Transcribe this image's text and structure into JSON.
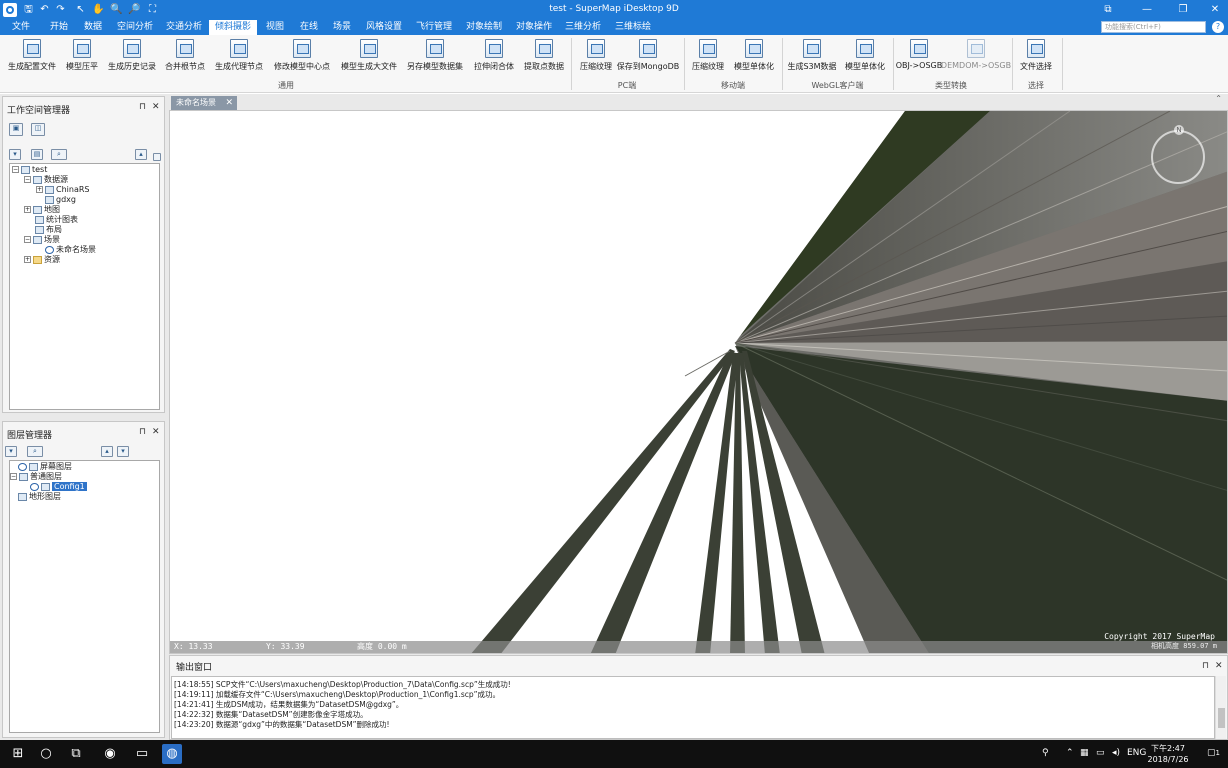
{
  "window": {
    "title": "test - SuperMap iDesktop 9D",
    "controls": [
      "⧉",
      "—",
      "❐",
      "✕"
    ]
  },
  "quick_access": [
    "🖫",
    "↶",
    "↷",
    "↖",
    "✋",
    "🔍",
    "🔎",
    "⛶"
  ],
  "menu": {
    "items": [
      "文件",
      "开始",
      "数据",
      "空间分析",
      "交通分析",
      "倾斜摄影",
      "视图",
      "在线",
      "场景",
      "风格设置",
      "飞行管理",
      "对象绘制",
      "对象操作",
      "三维分析",
      "三维标绘"
    ],
    "active": "倾斜摄影",
    "search_placeholder": "功能搜索(Ctrl+F)",
    "help": "?"
  },
  "ribbon": {
    "buttons": [
      {
        "label": "生成配置文件",
        "enabled": true
      },
      {
        "label": "模型压平",
        "enabled": true
      },
      {
        "label": "生成历史记录",
        "enabled": true
      },
      {
        "label": "合并根节点",
        "enabled": true
      },
      {
        "label": "生成代理节点",
        "enabled": true
      },
      {
        "label": "修改模型中心点",
        "enabled": true
      },
      {
        "label": "模型生成大文件",
        "enabled": true
      },
      {
        "label": "另存模型数据集",
        "enabled": true
      },
      {
        "label": "拉伸闭合体",
        "enabled": true
      },
      {
        "label": "提取点数据",
        "enabled": true
      },
      {
        "label": "压缩纹理",
        "enabled": true
      },
      {
        "label": "保存到MongoDB",
        "enabled": true
      },
      {
        "label": "压缩纹理",
        "enabled": true
      },
      {
        "label": "模型单体化",
        "enabled": true
      },
      {
        "label": "生成S3M数据",
        "enabled": true
      },
      {
        "label": "模型单体化",
        "enabled": true
      },
      {
        "label": "OBJ->OSGB",
        "enabled": true
      },
      {
        "label": "DEMDOM->OSGB",
        "enabled": false
      },
      {
        "label": "文件选择",
        "enabled": true
      }
    ],
    "groups": [
      "通用",
      "PC端",
      "移动端",
      "WebGL客户端",
      "类型转换",
      "选择"
    ]
  },
  "workspace_panel": {
    "title": "工作空间管理器",
    "tree": [
      {
        "label": "test",
        "expander": "⊟",
        "icon": "workspace-icon"
      },
      {
        "label": "数据源",
        "expander": "⊟",
        "icon": "datasource-icon"
      },
      {
        "label": "ChinaRS",
        "expander": "⊞",
        "icon": "database-icon"
      },
      {
        "label": "gdxg",
        "expander": "",
        "icon": "database-icon"
      },
      {
        "label": "地图",
        "expander": "⊞",
        "icon": "map-icon"
      },
      {
        "label": "统计图表",
        "expander": "",
        "icon": "chart-icon"
      },
      {
        "label": "布局",
        "expander": "",
        "icon": "layout-icon"
      },
      {
        "label": "场景",
        "expander": "⊟",
        "icon": "scene-icon"
      },
      {
        "label": "未命名场景",
        "expander": "",
        "icon": "globe-icon"
      },
      {
        "label": "资源",
        "expander": "⊞",
        "icon": "resource-icon"
      }
    ]
  },
  "layer_panel": {
    "title": "图层管理器",
    "tree": [
      {
        "label": "屏幕图层",
        "expander": "",
        "icon": "screen-layer-icon"
      },
      {
        "label": "普通图层",
        "expander": "⊟",
        "icon": "normal-layer-icon"
      },
      {
        "label": "Config1",
        "expander": "",
        "icon": "model-layer-icon"
      },
      {
        "label": "地形图层",
        "expander": "",
        "icon": "terrain-layer-icon"
      }
    ]
  },
  "scene": {
    "tab_label": "未命名场景",
    "compass_label": "N",
    "x_label": "X: 13.33",
    "y_label": "Y: 33.39",
    "h_label": "高度 0.00 m",
    "copyright": "Copyright 2017 SuperMap",
    "altitude": "相机高度 859.07 m"
  },
  "output": {
    "title": "输出窗口",
    "lines": [
      "[14:18:55] SCP文件“C:\\Users\\maxucheng\\Desktop\\Production_7\\Data\\Config.scp”生成成功!",
      "[14:19:11] 加载缓存文件“C:\\Users\\maxucheng\\Desktop\\Production_1\\Config1.scp”成功。",
      "[14:21:41] 生成DSM成功，结果数据集为“DatasetDSM@gdxg”。",
      "[14:22:32] 数据集“DatasetDSM”创建影像金字塔成功。",
      "[14:23:20] 数据源“gdxg”中的数据集“DatasetDSM”删除成功!"
    ]
  },
  "taskbar": {
    "time": "下午2:47",
    "date": "2018/7/26",
    "lang": "ENG",
    "notify_count": "1"
  }
}
